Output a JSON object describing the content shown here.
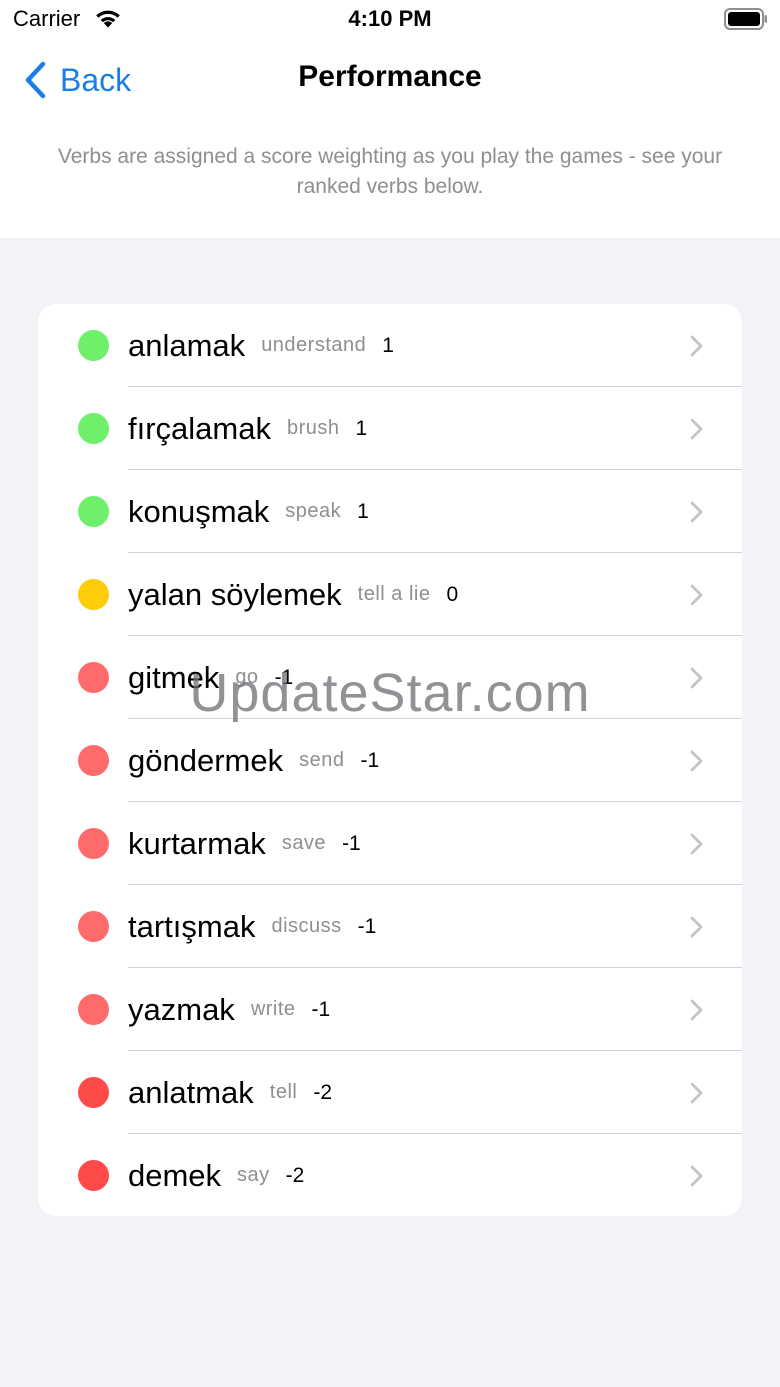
{
  "status_bar": {
    "carrier": "Carrier",
    "time": "4:10 PM"
  },
  "nav": {
    "back_label": "Back",
    "title": "Performance"
  },
  "subtitle": "Verbs are assigned a score weighting as you play the games - see your ranked verbs below.",
  "verbs": [
    {
      "verb": "anlamak",
      "meaning": "understand",
      "score": "1",
      "color": "#6ef06a"
    },
    {
      "verb": "fırçalamak",
      "meaning": "brush",
      "score": "1",
      "color": "#6ef06a"
    },
    {
      "verb": "konuşmak",
      "meaning": "speak",
      "score": "1",
      "color": "#6ef06a"
    },
    {
      "verb": "yalan söylemek",
      "meaning": "tell a lie",
      "score": "0",
      "color": "#ffcc0a"
    },
    {
      "verb": "gitmek",
      "meaning": "go",
      "score": "-1",
      "color": "#ff6b6b"
    },
    {
      "verb": "göndermek",
      "meaning": "send",
      "score": "-1",
      "color": "#ff6b6b"
    },
    {
      "verb": "kurtarmak",
      "meaning": "save",
      "score": "-1",
      "color": "#ff6b6b"
    },
    {
      "verb": "tartışmak",
      "meaning": "discuss",
      "score": "-1",
      "color": "#ff6b6b"
    },
    {
      "verb": "yazmak",
      "meaning": "write",
      "score": "-1",
      "color": "#ff6b6b"
    },
    {
      "verb": "anlatmak",
      "meaning": "tell",
      "score": "-2",
      "color": "#ff4a4a"
    },
    {
      "verb": "demek",
      "meaning": "say",
      "score": "-2",
      "color": "#ff4a4a"
    }
  ],
  "watermark": "UpdateStar.com",
  "colors": {
    "accent": "#1a7ee8",
    "background": "#f2f2f7",
    "secondary_text": "#8e8e93"
  }
}
